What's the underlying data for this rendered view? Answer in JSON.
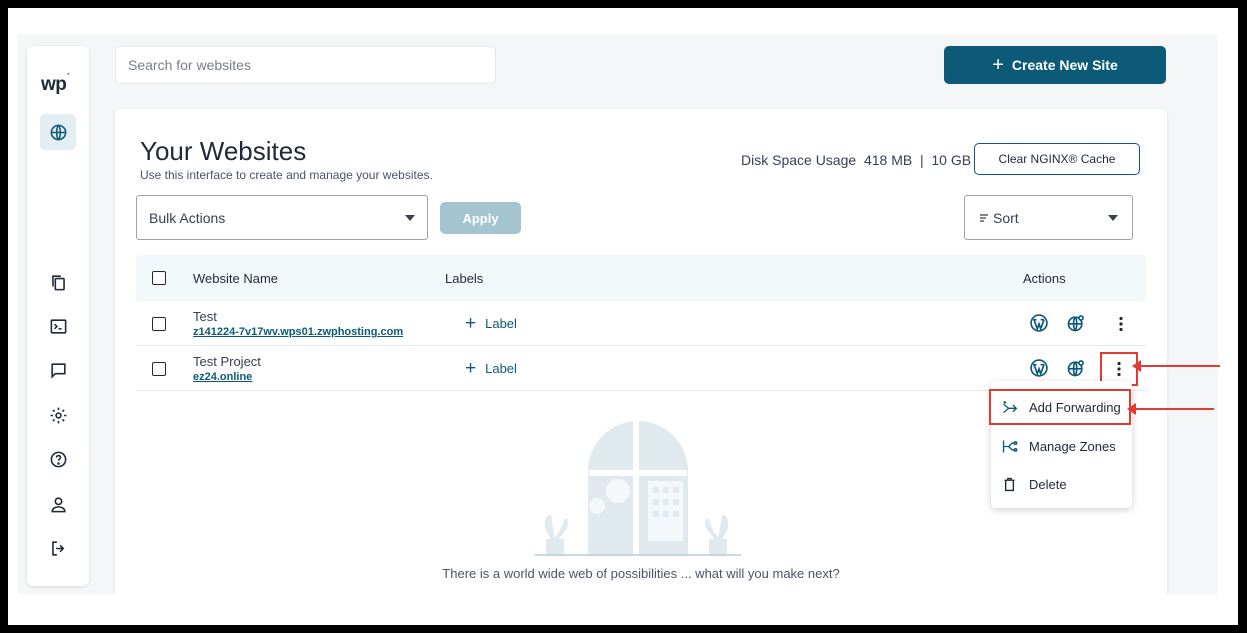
{
  "search": {
    "placeholder": "Search for websites"
  },
  "header": {
    "create_label": "Create New Site",
    "create_icon": "plus-icon"
  },
  "sidebar": {
    "logo": "wp",
    "items": [
      {
        "name": "globe-icon",
        "active": true
      },
      {
        "name": "copy-icon"
      },
      {
        "name": "terminal-icon"
      },
      {
        "name": "chat-icon"
      },
      {
        "name": "settings-icon"
      },
      {
        "name": "help-icon"
      },
      {
        "name": "user-icon"
      },
      {
        "name": "logout-icon"
      }
    ]
  },
  "main": {
    "title": "Your Websites",
    "subtitle": "Use this interface to create and manage your websites.",
    "disk_label": "Disk Space Usage",
    "disk_value": "418 MB  |  10 GB",
    "clear_cache": "Clear NGINX® Cache",
    "bulk_actions": "Bulk Actions",
    "apply": "Apply",
    "sort": "Sort"
  },
  "table": {
    "columns": [
      "Website Name",
      "Labels",
      "Actions"
    ],
    "rows": [
      {
        "name": "Test",
        "url": "z141224-7v17wv.wps01.zwphosting.com",
        "label": "Label"
      },
      {
        "name": "Test Project",
        "url": "ez24.online",
        "label": "Label"
      }
    ]
  },
  "menu": {
    "items": [
      {
        "label": "Add Forwarding",
        "icon": "forward-icon"
      },
      {
        "label": "Manage Zones",
        "icon": "zones-icon"
      },
      {
        "label": "Delete",
        "icon": "trash-icon"
      }
    ]
  },
  "empty_state": {
    "text": "There is a world wide web of possibilities ... what will you make next?"
  },
  "colors": {
    "brand": "#0c5a78",
    "highlight": "#e53935",
    "apply_disabled": "#a4c4d0"
  }
}
